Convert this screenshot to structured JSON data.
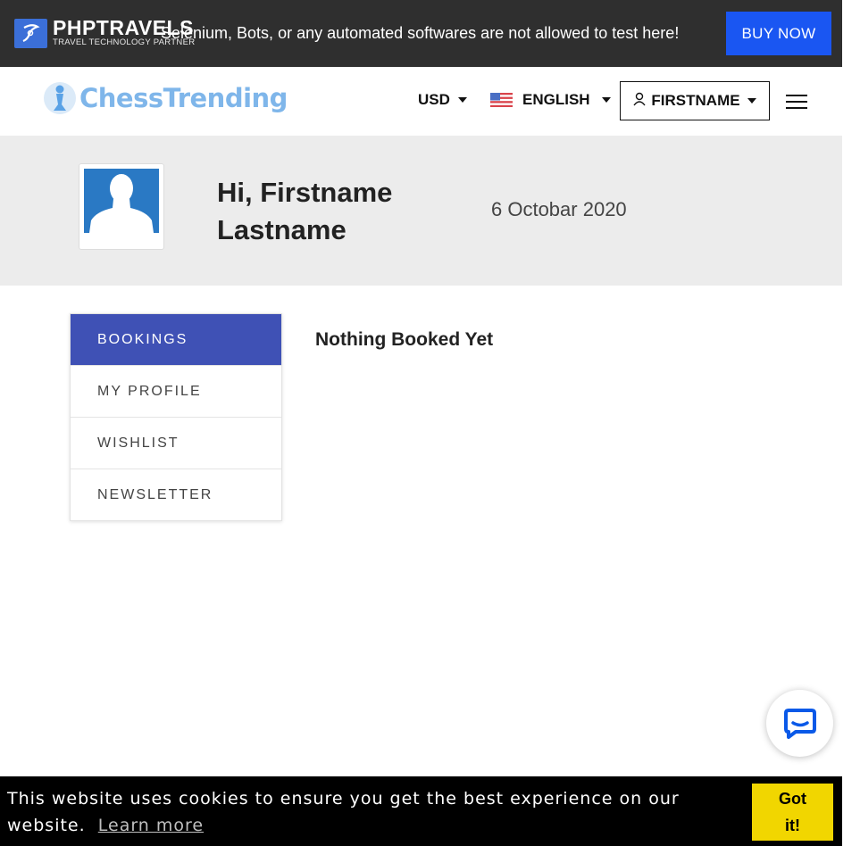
{
  "topbar": {
    "logo_brand": "PHPTRAVELS",
    "logo_tagline": "TRAVEL TECHNOLOGY PARTNER",
    "notice": "Selenium, Bots, or any automated softwares are not allowed to test here!",
    "buy_now_label": "BUY NOW",
    "buy_now_color": "#1a56f2"
  },
  "header": {
    "site_name": "ChessTrending",
    "currency_label": "USD",
    "language_label": "ENGLISH",
    "language_flag": "us-flag-icon",
    "user_label": "FIRSTNAME",
    "menu_icon": "hamburger-icon"
  },
  "profile": {
    "greeting": "Hi, Firstname Lastname",
    "date": "6 Octobar 2020",
    "avatar_icon": "user-silhouette-icon"
  },
  "sidebar": {
    "items": [
      {
        "label": "BOOKINGS",
        "active": true
      },
      {
        "label": "MY PROFILE",
        "active": false
      },
      {
        "label": "WISHLIST",
        "active": false
      },
      {
        "label": "NEWSLETTER",
        "active": false
      }
    ],
    "active_color": "#3f51b5"
  },
  "main": {
    "empty_message": "Nothing Booked Yet"
  },
  "chat": {
    "icon": "chat-bubble-icon",
    "color": "#0a59e8"
  },
  "cookie": {
    "message": "This website uses cookies to ensure you get the best experience on our website.",
    "learn_more": "Learn more",
    "accept_label": "Got it!",
    "accept_color": "#f1d600"
  }
}
